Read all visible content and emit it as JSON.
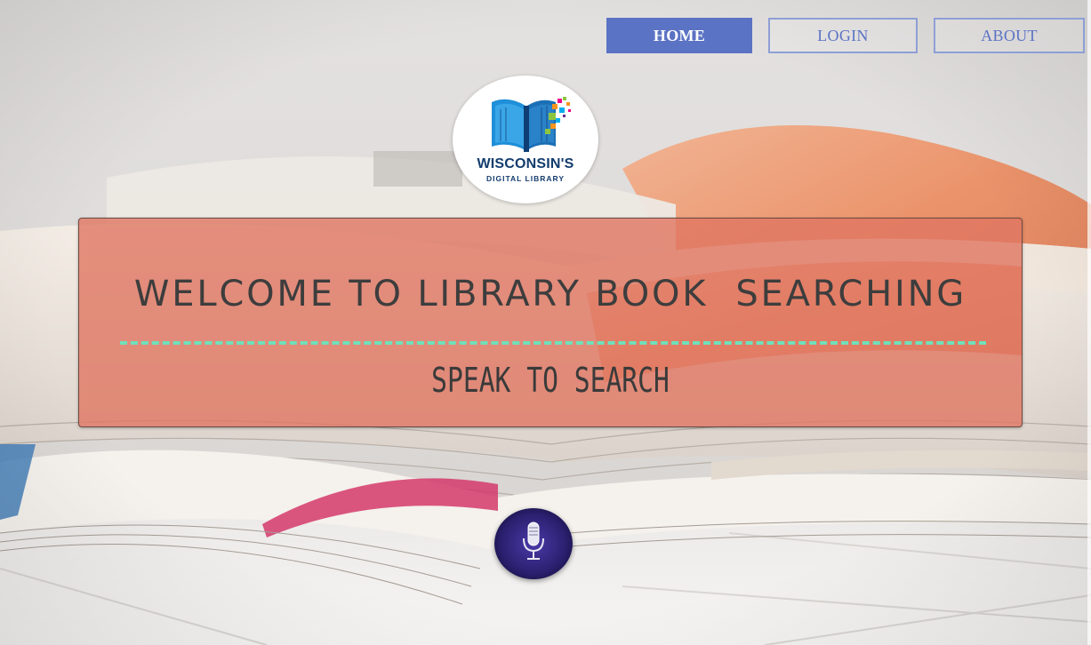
{
  "nav": {
    "home_label": "HOME",
    "login_label": "LOGIN",
    "about_label": "ABOUT"
  },
  "logo": {
    "title": "WISCONSIN'S",
    "subtitle": "DIGITAL LIBRARY"
  },
  "hero": {
    "title": "WELCOME TO LIBRARY BOOK  SEARCHING",
    "subtitle": "SPEAK TO SEARCH"
  },
  "mic": {
    "icon": "microphone-icon"
  },
  "colors": {
    "nav_active": "#5b73c4",
    "nav_border": "#8e9fd6",
    "hero_overlay": "#e07662",
    "divider": "#6fe0bb",
    "logo_text": "#133c6e"
  }
}
